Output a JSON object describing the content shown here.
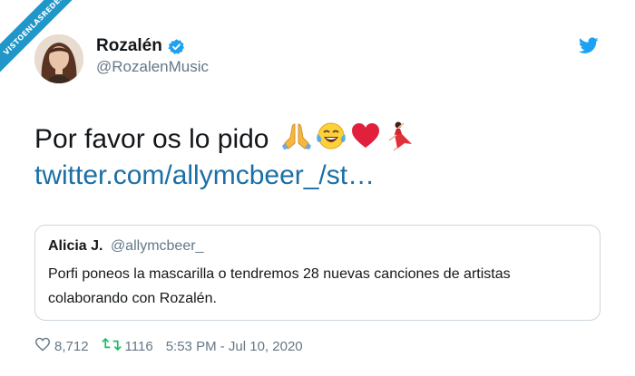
{
  "watermark": "VISTOENLASREDES",
  "author": {
    "name": "Rozalén",
    "handle": "@RozalenMusic"
  },
  "tweet": {
    "text": "Por favor os lo pido",
    "emojis": [
      "folded-hands",
      "tears-of-joy",
      "red-heart",
      "dancer"
    ],
    "link": "twitter.com/allymcbeer_/st…"
  },
  "quoted_tweet": {
    "name": "Alicia J.",
    "handle": "@allymcbeer_",
    "text": "Porfi poneos la mascarilla o tendremos 28 nuevas canciones de artistas colaborando con Rozalén."
  },
  "footer": {
    "likes": "8,712",
    "retweets": "1116",
    "timestamp": "5:53 PM - Jul 10, 2020"
  },
  "colors": {
    "link": "#1b6fa6",
    "twitter_blue": "#1da1f2",
    "secondary_text": "#657786",
    "border": "#ccd6dd"
  }
}
